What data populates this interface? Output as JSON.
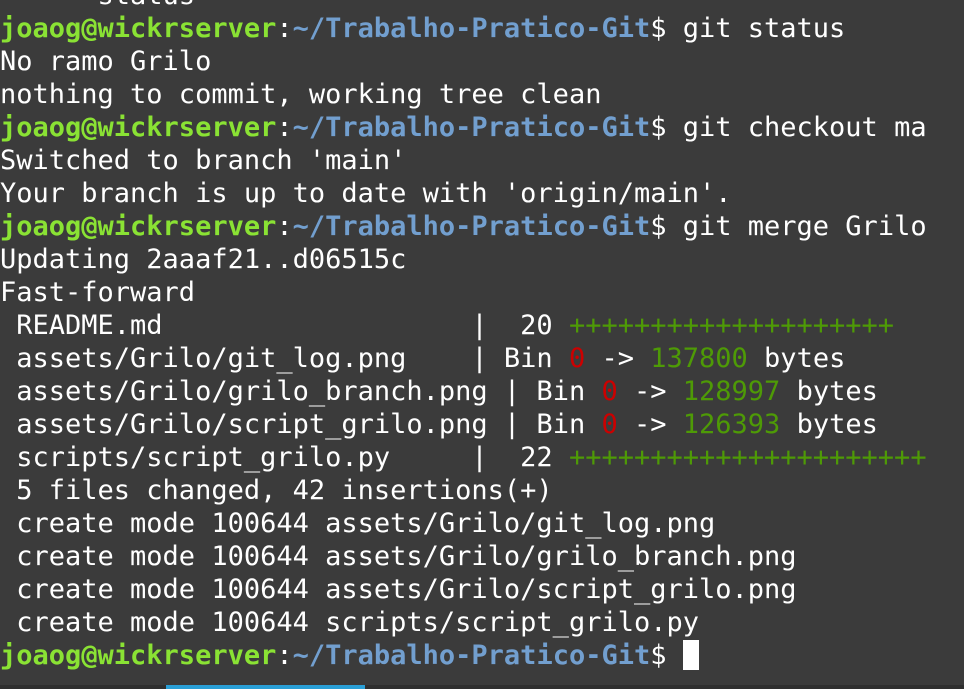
{
  "prompt": {
    "user_host": "joaog@wickrserver",
    "sep": ":",
    "path": "~/Trabalho-Pratico-Git",
    "symbol": "$ "
  },
  "clipped_top_text": "      status",
  "cmd1": "git status",
  "out1": [
    "No ramo Grilo",
    "nothing to commit, working tree clean"
  ],
  "cmd2": "git checkout ma",
  "out2": [
    "Switched to branch 'main'",
    "Your branch is up to date with 'origin/main'."
  ],
  "cmd3": "git merge Grilo",
  "out3": [
    "Updating 2aaaf21..d06515c",
    "Fast-forward"
  ],
  "stat_rows": [
    {
      "name": " README.md                   ",
      "sep": "|  20 ",
      "plus": "++++++++++++++++++++"
    },
    {
      "name": " assets/Grilo/git_log.png    ",
      "sep": "| Bin ",
      "old": "0",
      "arrow": " -> ",
      "new": "137800",
      "unit": " bytes"
    },
    {
      "name": " assets/Grilo/grilo_branch.png ",
      "sep": "| Bin ",
      "old": "0",
      "arrow": " -> ",
      "new": "128997",
      "unit": " bytes"
    },
    {
      "name": " assets/Grilo/script_grilo.png ",
      "sep": "| Bin ",
      "old": "0",
      "arrow": " -> ",
      "new": "126393",
      "unit": " bytes"
    },
    {
      "name": " scripts/script_grilo.py     ",
      "sep": "|  22 ",
      "plus": "++++++++++++++++++++++"
    }
  ],
  "summary": " 5 files changed, 42 insertions(+)",
  "create_lines": [
    " create mode 100644 assets/Grilo/git_log.png",
    " create mode 100644 assets/Grilo/grilo_branch.png",
    " create mode 100644 assets/Grilo/script_grilo.png",
    " create mode 100644 scripts/script_grilo.py"
  ],
  "colors": {
    "background": "#3b3b3b",
    "user": "#8ae234",
    "path": "#729fcf",
    "bin_old": "#cc0000",
    "bin_new": "#4e9a06",
    "tab_accent": "#2a9fd6"
  }
}
